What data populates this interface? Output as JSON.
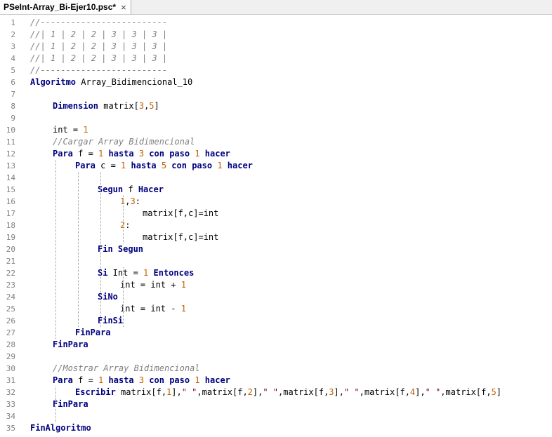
{
  "tab": {
    "title": "PSeInt-Array_Bi-Ejer10.psc*",
    "close_symbol": "×"
  },
  "colors": {
    "keyword": "#000080",
    "comment": "#808080",
    "number": "#c06000",
    "string": "#800000"
  },
  "lines": [
    {
      "n": "1",
      "indent": 0,
      "tokens": [
        [
          "cm",
          "//-------------------------"
        ]
      ]
    },
    {
      "n": "2",
      "indent": 0,
      "tokens": [
        [
          "cm",
          "//| 1 | 2 | 2 | 3 | 3 | 3 |"
        ]
      ]
    },
    {
      "n": "3",
      "indent": 0,
      "tokens": [
        [
          "cm",
          "//| 1 | 2 | 2 | 3 | 3 | 3 |"
        ]
      ]
    },
    {
      "n": "4",
      "indent": 0,
      "tokens": [
        [
          "cm",
          "//| 1 | 2 | 2 | 3 | 3 | 3 |"
        ]
      ]
    },
    {
      "n": "5",
      "indent": 0,
      "tokens": [
        [
          "cm",
          "//-------------------------"
        ]
      ]
    },
    {
      "n": "6",
      "indent": 0,
      "tokens": [
        [
          "kw",
          "Algoritmo"
        ],
        [
          "t",
          " Array_Bidimencional_10"
        ]
      ]
    },
    {
      "n": "7",
      "indent": 0,
      "tokens": []
    },
    {
      "n": "8",
      "indent": 1,
      "tokens": [
        [
          "kw",
          "Dimension"
        ],
        [
          "t",
          " matrix["
        ],
        [
          "num",
          "3"
        ],
        [
          "t",
          ","
        ],
        [
          "num",
          "5"
        ],
        [
          "t",
          "]"
        ]
      ]
    },
    {
      "n": "9",
      "indent": 0,
      "tokens": []
    },
    {
      "n": "10",
      "indent": 1,
      "tokens": [
        [
          "t",
          "int = "
        ],
        [
          "num",
          "1"
        ]
      ]
    },
    {
      "n": "11",
      "indent": 1,
      "tokens": [
        [
          "cm",
          "//Cargar Array Bidimencional"
        ]
      ]
    },
    {
      "n": "12",
      "indent": 1,
      "tokens": [
        [
          "kw",
          "Para"
        ],
        [
          "t",
          " f = "
        ],
        [
          "num",
          "1"
        ],
        [
          "kw",
          " hasta "
        ],
        [
          "num",
          "3"
        ],
        [
          "kw",
          " con paso "
        ],
        [
          "num",
          "1"
        ],
        [
          "kw",
          " hacer"
        ]
      ]
    },
    {
      "n": "13",
      "indent": 2,
      "tokens": [
        [
          "kw",
          "Para"
        ],
        [
          "t",
          " c = "
        ],
        [
          "num",
          "1"
        ],
        [
          "kw",
          " hasta "
        ],
        [
          "num",
          "5"
        ],
        [
          "kw",
          " con paso "
        ],
        [
          "num",
          "1"
        ],
        [
          "kw",
          " hacer"
        ]
      ]
    },
    {
      "n": "14",
      "indent": 0,
      "tokens": []
    },
    {
      "n": "15",
      "indent": 3,
      "tokens": [
        [
          "kw",
          "Segun"
        ],
        [
          "t",
          " f "
        ],
        [
          "kw",
          "Hacer"
        ]
      ]
    },
    {
      "n": "16",
      "indent": 4,
      "tokens": [
        [
          "num",
          "1"
        ],
        [
          "t",
          ","
        ],
        [
          "num",
          "3"
        ],
        [
          "t",
          ":"
        ]
      ]
    },
    {
      "n": "17",
      "indent": 5,
      "tokens": [
        [
          "t",
          "matrix[f,c]=int"
        ]
      ]
    },
    {
      "n": "18",
      "indent": 4,
      "tokens": [
        [
          "num",
          "2"
        ],
        [
          "t",
          ":"
        ]
      ]
    },
    {
      "n": "19",
      "indent": 5,
      "tokens": [
        [
          "t",
          "matrix[f,c]=int"
        ]
      ]
    },
    {
      "n": "20",
      "indent": 3,
      "tokens": [
        [
          "kw",
          "Fin Segun"
        ]
      ]
    },
    {
      "n": "21",
      "indent": 0,
      "tokens": []
    },
    {
      "n": "22",
      "indent": 3,
      "tokens": [
        [
          "kw",
          "Si"
        ],
        [
          "t",
          " Int = "
        ],
        [
          "num",
          "1"
        ],
        [
          "kw",
          " Entonces"
        ]
      ]
    },
    {
      "n": "23",
      "indent": 4,
      "tokens": [
        [
          "t",
          "int = int + "
        ],
        [
          "num",
          "1"
        ]
      ]
    },
    {
      "n": "24",
      "indent": 3,
      "tokens": [
        [
          "kw",
          "SiNo"
        ]
      ]
    },
    {
      "n": "25",
      "indent": 4,
      "tokens": [
        [
          "t",
          "int = int - "
        ],
        [
          "num",
          "1"
        ]
      ]
    },
    {
      "n": "26",
      "indent": 3,
      "tokens": [
        [
          "kw",
          "FinSi"
        ]
      ]
    },
    {
      "n": "27",
      "indent": 2,
      "tokens": [
        [
          "kw",
          "FinPara"
        ]
      ]
    },
    {
      "n": "28",
      "indent": 1,
      "tokens": [
        [
          "kw",
          "FinPara"
        ]
      ]
    },
    {
      "n": "29",
      "indent": 0,
      "tokens": []
    },
    {
      "n": "30",
      "indent": 1,
      "tokens": [
        [
          "cm",
          "//Mostrar Array Bidimencional"
        ]
      ]
    },
    {
      "n": "31",
      "indent": 1,
      "tokens": [
        [
          "kw",
          "Para"
        ],
        [
          "t",
          " f = "
        ],
        [
          "num",
          "1"
        ],
        [
          "kw",
          " hasta "
        ],
        [
          "num",
          "3"
        ],
        [
          "kw",
          " con paso "
        ],
        [
          "num",
          "1"
        ],
        [
          "kw",
          " hacer"
        ]
      ]
    },
    {
      "n": "32",
      "indent": 2,
      "tokens": [
        [
          "kw",
          "Escribir"
        ],
        [
          "t",
          " matrix[f,"
        ],
        [
          "num",
          "1"
        ],
        [
          "t",
          "],"
        ],
        [
          "str",
          "\" \""
        ],
        [
          "t",
          ",matrix[f,"
        ],
        [
          "num",
          "2"
        ],
        [
          "t",
          "],"
        ],
        [
          "str",
          "\" \""
        ],
        [
          "t",
          ",matrix[f,"
        ],
        [
          "num",
          "3"
        ],
        [
          "t",
          "],"
        ],
        [
          "str",
          "\" \""
        ],
        [
          "t",
          ",matrix[f,"
        ],
        [
          "num",
          "4"
        ],
        [
          "t",
          "],"
        ],
        [
          "str",
          "\" \""
        ],
        [
          "t",
          ",matrix[f,"
        ],
        [
          "num",
          "5"
        ],
        [
          "t",
          "]"
        ]
      ]
    },
    {
      "n": "33",
      "indent": 1,
      "tokens": [
        [
          "kw",
          "FinPara"
        ]
      ]
    },
    {
      "n": "34",
      "indent": 0,
      "tokens": []
    },
    {
      "n": "35",
      "indent": 0,
      "tokens": [
        [
          "kw",
          "FinAlgoritmo"
        ]
      ]
    }
  ]
}
